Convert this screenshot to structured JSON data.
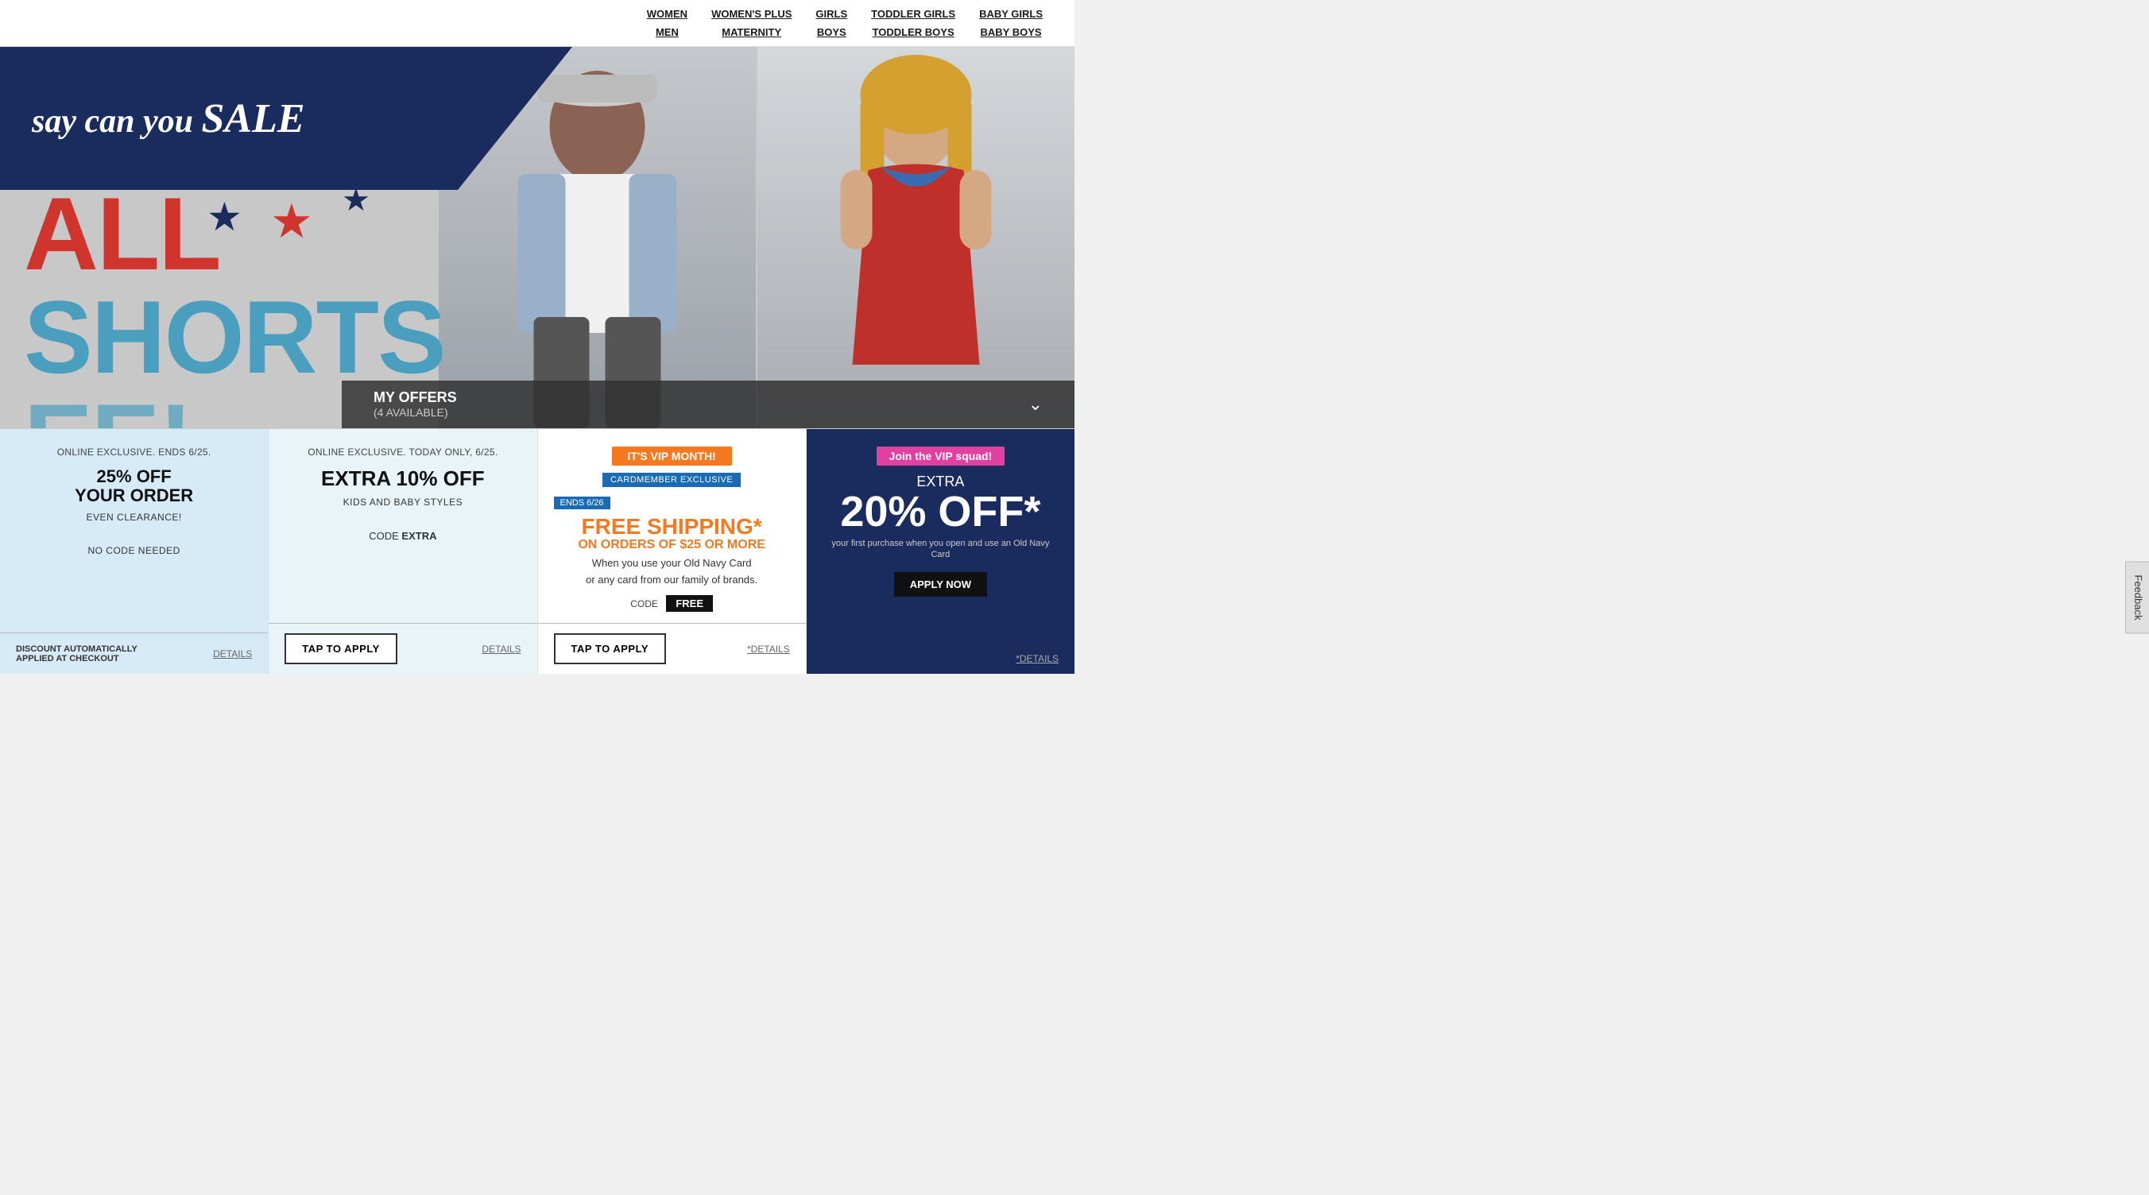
{
  "nav": {
    "links_row1": [
      {
        "label": "WOMEN",
        "id": "women"
      },
      {
        "label": "WOMEN'S PLUS",
        "id": "womens-plus"
      },
      {
        "label": "GIRLS",
        "id": "girls"
      },
      {
        "label": "TODDLER GIRLS",
        "id": "toddler-girls"
      },
      {
        "label": "BABY GIRLS",
        "id": "baby-girls"
      }
    ],
    "links_row2": [
      {
        "label": "MEN",
        "id": "men"
      },
      {
        "label": "MATERNITY",
        "id": "maternity"
      },
      {
        "label": "BOYS",
        "id": "boys"
      },
      {
        "label": "TODDLER BOYS",
        "id": "toddler-boys"
      },
      {
        "label": "BABY BOYS",
        "id": "baby-boys"
      }
    ]
  },
  "hero": {
    "banner_text": "say can you",
    "banner_sale": "SALE",
    "line1": "ALL",
    "line2": "SHORTS",
    "line3": "EE!"
  },
  "my_offers": {
    "title": "MY OFFERS",
    "count": "(4 AVAILABLE)"
  },
  "feedback": {
    "label": "Feedback"
  },
  "offers": [
    {
      "id": "offer-1",
      "subtitle": "ONLINE EXCLUSIVE. ENDS 6/25.",
      "main_title": "25% OFF\nYOUR ORDER",
      "sub1": "EVEN CLEARANCE!",
      "code_label": "",
      "code": "",
      "footer_left": "DISCOUNT AUTOMATICALLY\nAPPLIED AT CHECKOUT",
      "footer_right": "DETAILS",
      "has_tap": false,
      "type": "light-blue"
    },
    {
      "id": "offer-2",
      "subtitle": "ONLINE EXCLUSIVE. TODAY ONLY, 6/25.",
      "main_title": "EXTRA 10% OFF",
      "sub1": "KIDS AND BABY STYLES",
      "code_label": "CODE ",
      "code": "EXTRA",
      "footer_left": "",
      "footer_right": "DETAILS",
      "has_tap": true,
      "tap_label": "TAP TO APPLY",
      "type": "light-blue-2"
    },
    {
      "id": "offer-3",
      "vip_badge": "IT'S VIP MONTH!",
      "cardmember": "CARDMEMBER EXCLUSIVE",
      "ends": "ENDS 6/26",
      "free_shipping": "FREE SHIPPING*",
      "free_sub": "ON ORDERS OF $25 OR MORE",
      "free_desc1": "When you use your Old Navy Card",
      "free_desc2": "or any card from our family of brands.",
      "code_label": "CODE",
      "code": "FREE",
      "footer_right": "*DETAILS",
      "has_tap": true,
      "tap_label": "TAP TO APPLY",
      "type": "white"
    },
    {
      "id": "offer-4",
      "vip_squad": "Join the VIP squad!",
      "extra_label": "EXTRA",
      "big_number": "20% OFF*",
      "vip_sub": "your first purchase when you open and use an Old Navy Card",
      "apply_btn": "APPLY NOW",
      "footer_right": "*DETAILS",
      "has_tap": false,
      "type": "dark-blue"
    }
  ]
}
